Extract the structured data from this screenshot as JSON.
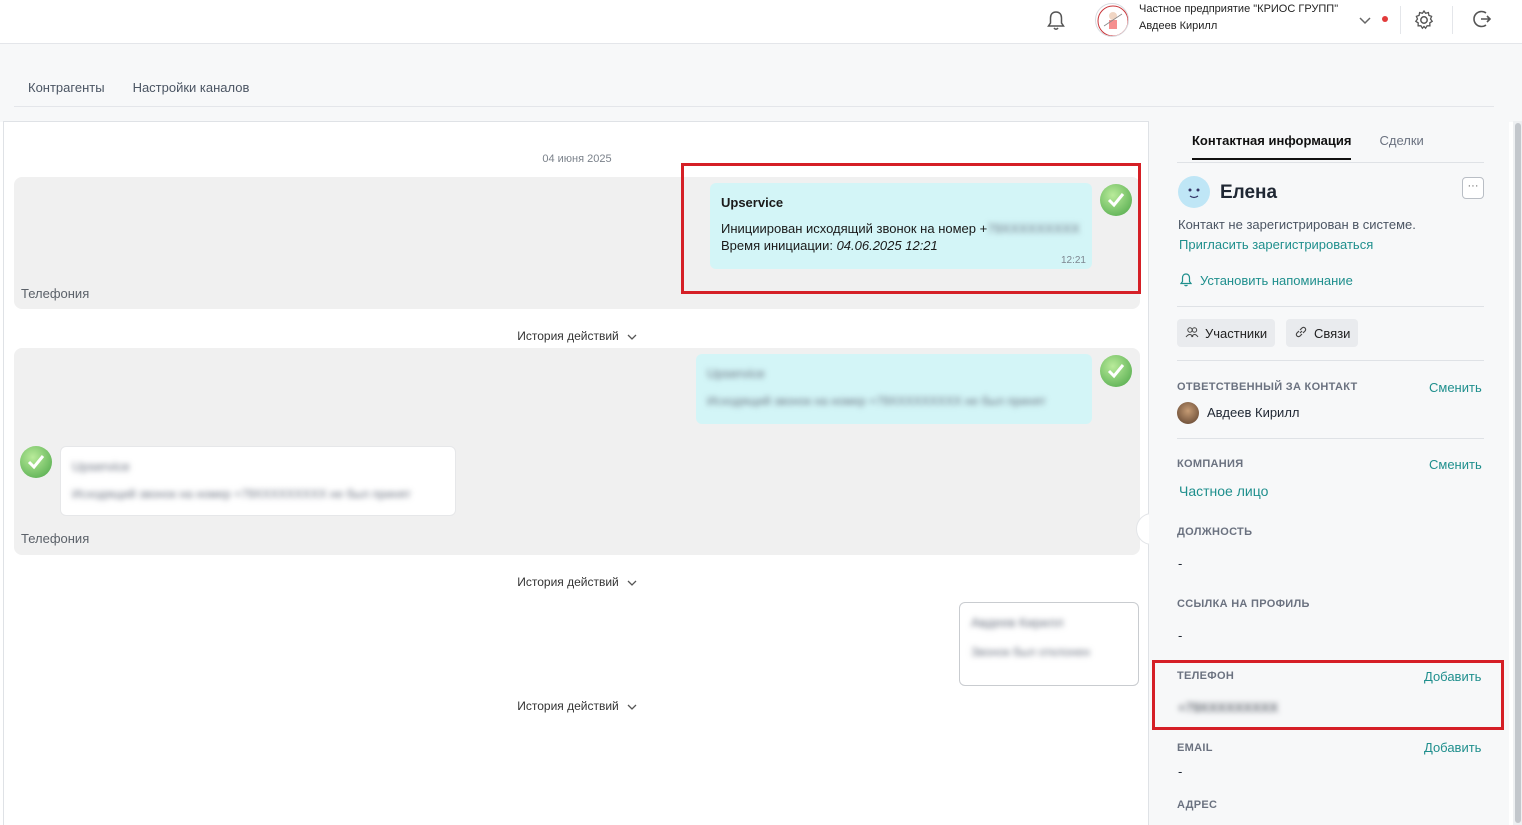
{
  "header": {
    "org_name": "Частное предприятие \"КРИОС ГРУПП\"",
    "user_name": "Авдеев Кирилл",
    "icons": [
      "bell-icon",
      "chevron-down-icon",
      "gear-icon",
      "logout-icon"
    ]
  },
  "subtabs": [
    "Контрагенты",
    "Настройки каналов"
  ],
  "chat": {
    "date": "04 июня 2025",
    "group1": {
      "channel": "Телефония",
      "bubble": {
        "title": "Upservice",
        "line1": "Инициирован исходящий звонок на номер +",
        "line1_blurred": "79XXXXXXXXX",
        "line2_label": "Время инициации: ",
        "line2_value": "04.06.2025 12:21",
        "time": "12:21"
      }
    },
    "history_label": "История действий",
    "group2": {
      "channel": "Телефония",
      "out_title": "Upservice",
      "out_text": "Исходящий звонок на номер +79XXXXXXXXX не был принят",
      "in_title": "Upservice",
      "in_text": "Исходящий звонок на номер +79XXXXXXXXX не был принят"
    },
    "message3": {
      "author": "Авдеев Кирилл",
      "text": "Звонок был отклонен"
    }
  },
  "contact": {
    "tabs": [
      "Контактная информация",
      "Сделки"
    ],
    "name": "Елена",
    "not_registered": "Контакт не зарегистрирован в системе.",
    "invite_link": "Пригласить зарегистрироваться",
    "reminder": "Установить напоминание",
    "chips": [
      "Участники",
      "Связи"
    ],
    "responsible_title": "ОТВЕТСТВЕННЫЙ ЗА КОНТАКТ",
    "change": "Сменить",
    "responsible_name": "Авдеев Кирилл",
    "company_title": "КОМПАНИЯ",
    "company_value": "Частное лицо",
    "position_title": "ДОЛЖНОСТЬ",
    "position_value": "-",
    "profile_title": "ССЫЛКА НА ПРОФИЛЬ",
    "profile_value": "-",
    "phone_title": "ТЕЛЕФОН",
    "add": "Добавить",
    "phone_value": "+79XXXXXXXXX",
    "email_title": "EMAIL",
    "email_value": "-",
    "address_title": "АДРЕС"
  },
  "colors": {
    "accent": "#1f8f8d",
    "highlight_box": "#d51f26",
    "out_bubble": "#d3f5f7"
  }
}
